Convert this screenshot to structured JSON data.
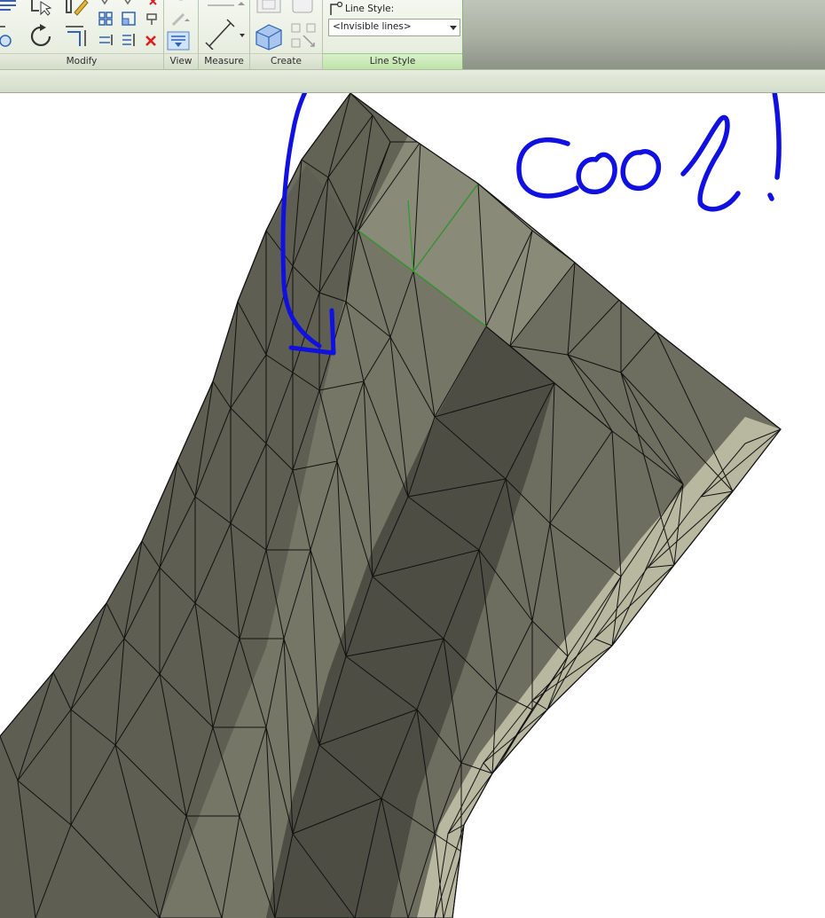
{
  "ribbon": {
    "panels": {
      "modify": "Modify",
      "view": "View",
      "measure": "Measure",
      "create": "Create",
      "line_style": "Line Style"
    },
    "line_style": {
      "caption": "Line Style:",
      "selected": "<Invisible lines>"
    }
  },
  "annotation": {
    "text": "cool!",
    "color": "#1010e0"
  },
  "colors": {
    "mesh_edge": "#111111",
    "highlight_edge": "#2e9b2e",
    "accent_green": "#6abf4b"
  },
  "icons": [
    "align-icon",
    "offset-icon",
    "mirror-icon",
    "copy-icon",
    "rotate-icon",
    "trim-icon",
    "split-icon",
    "array-icon",
    "scale-icon",
    "pin-icon",
    "delete-icon",
    "paint-icon",
    "thin-lines-icon",
    "measure-icon",
    "model-in-place-icon",
    "line-style-icon"
  ]
}
